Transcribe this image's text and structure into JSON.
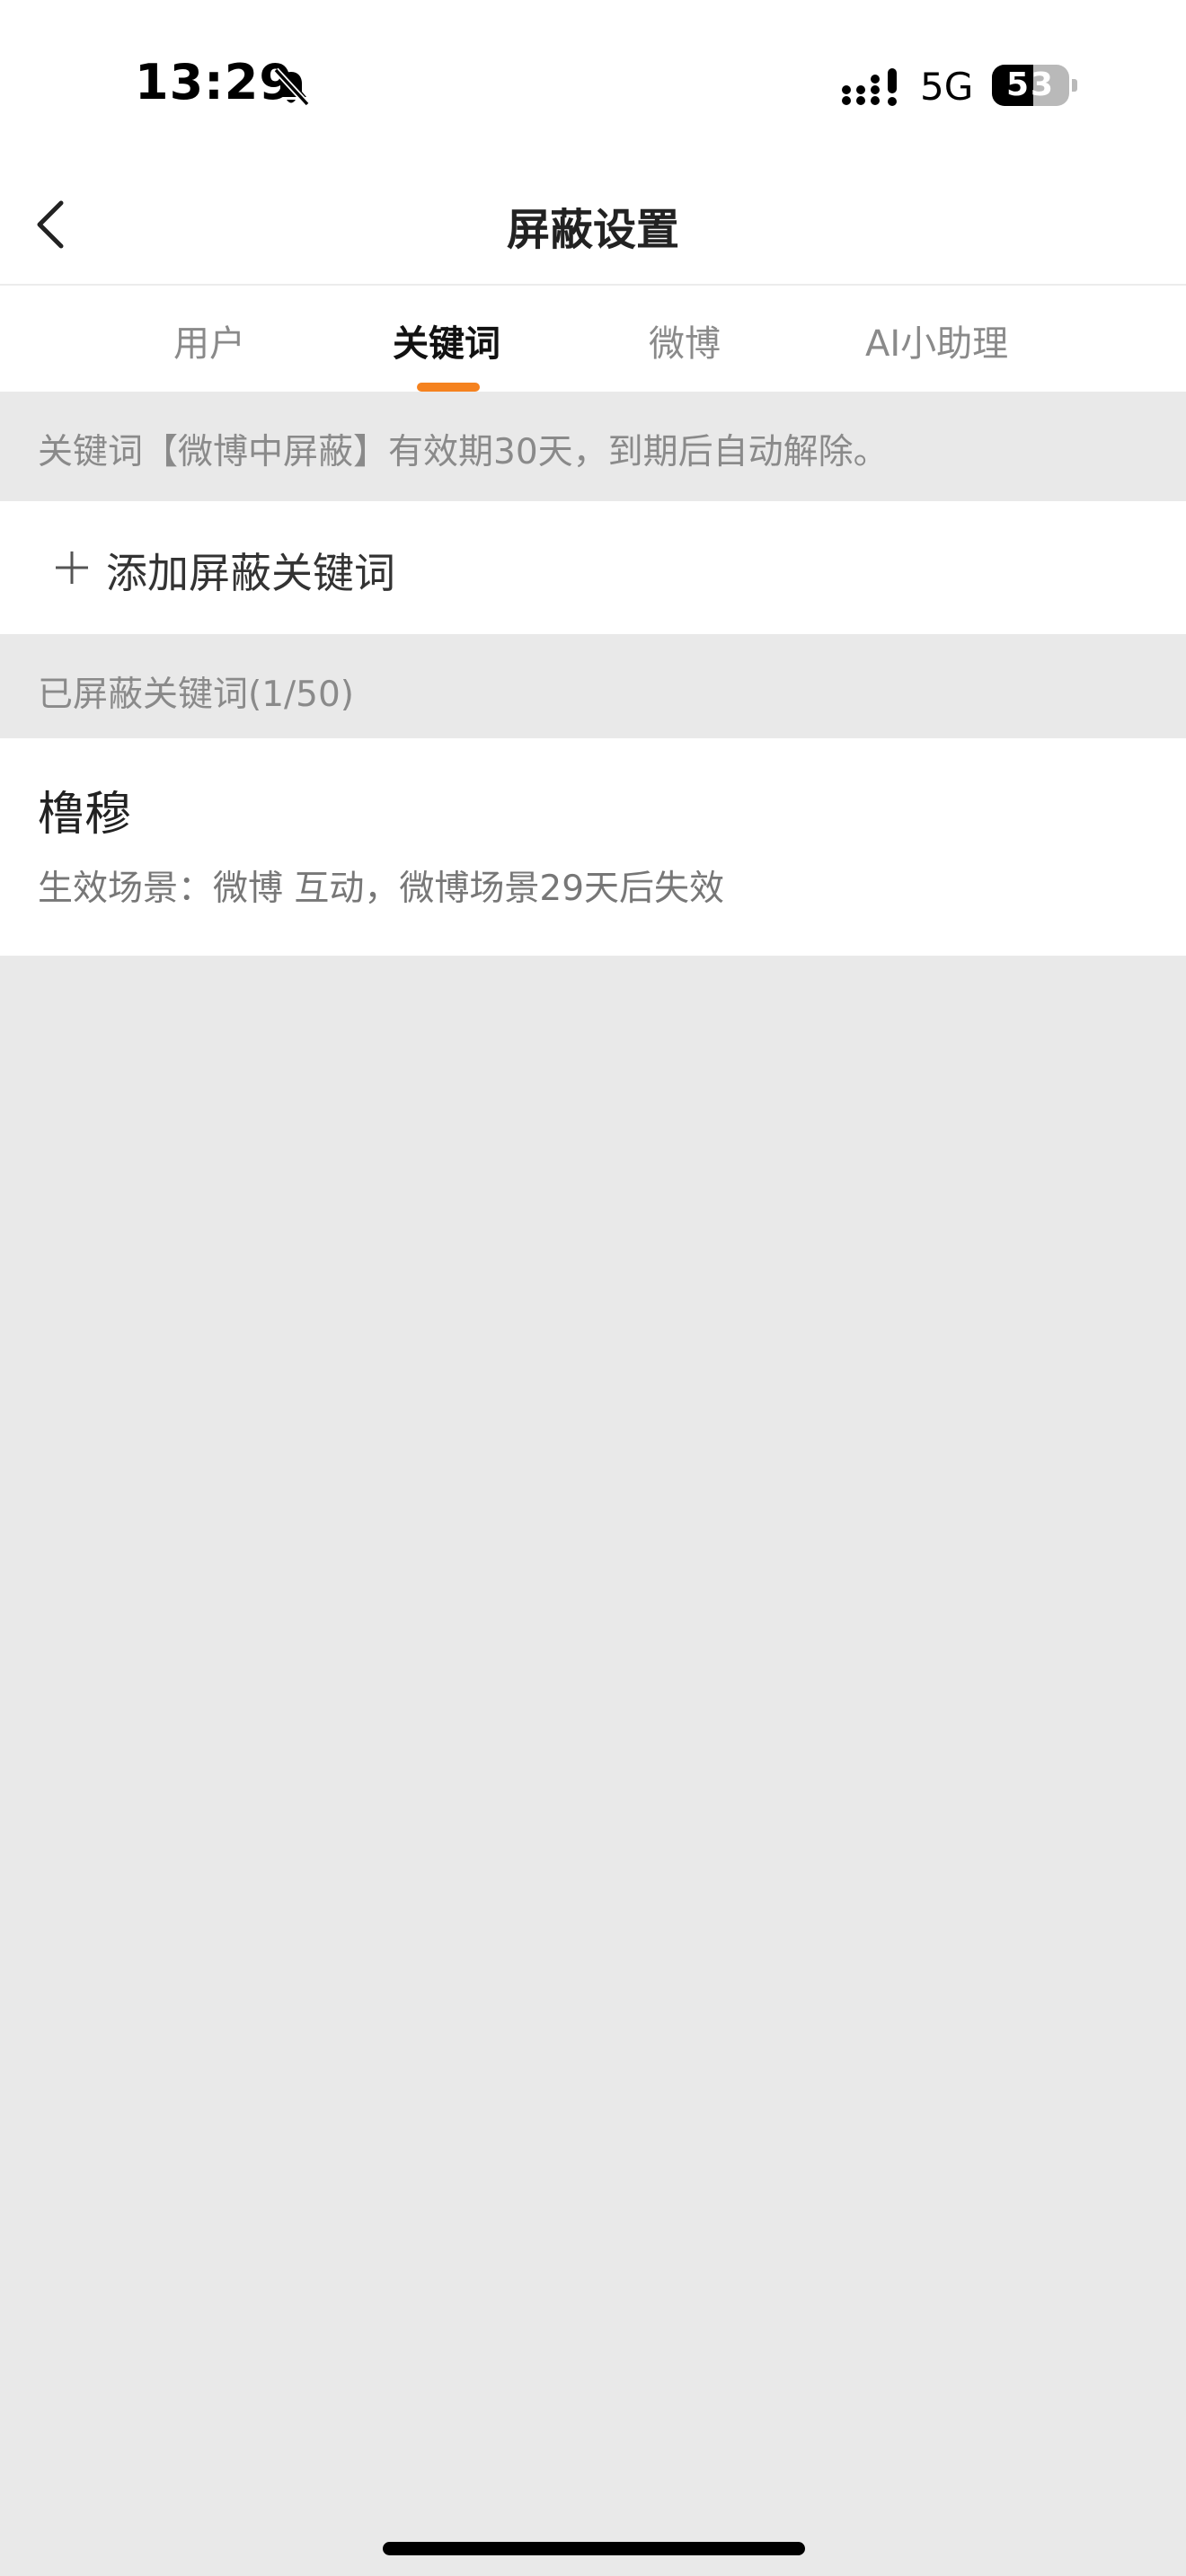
{
  "status_bar": {
    "time": "13:29",
    "network": "5G",
    "battery_level": "53",
    "battery_fraction": 0.53
  },
  "nav": {
    "title": "屏蔽设置"
  },
  "tabs": [
    {
      "label": "用户",
      "active": false
    },
    {
      "label": "关键词",
      "active": true
    },
    {
      "label": "微博",
      "active": false
    },
    {
      "label": "AI小助理",
      "active": false
    }
  ],
  "notice": {
    "text": "关键词【微博中屏蔽】有效期30天，到期后自动解除。"
  },
  "add_keyword": {
    "label": "添加屏蔽关键词"
  },
  "blocked_section": {
    "header": "已屏蔽关键词(1/50)"
  },
  "keywords": [
    {
      "word": "橹穆",
      "scene": "生效场景：微博 互动，微博场景29天后失效"
    }
  ],
  "icons": {
    "back": "chevron-left-icon",
    "bell": "bell-slash-icon",
    "signal": "signal-bars-icon",
    "battery": "battery-icon",
    "add": "plus-icon"
  },
  "colors": {
    "accent": "#f5821f",
    "background": "#e9e9e9",
    "surface": "#ffffff"
  }
}
